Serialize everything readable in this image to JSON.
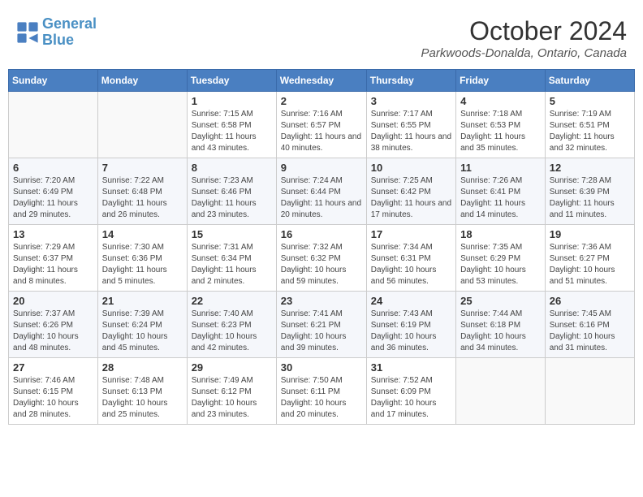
{
  "logo": {
    "line1": "General",
    "line2": "Blue"
  },
  "title": "October 2024",
  "location": "Parkwoods-Donalda, Ontario, Canada",
  "days_of_week": [
    "Sunday",
    "Monday",
    "Tuesday",
    "Wednesday",
    "Thursday",
    "Friday",
    "Saturday"
  ],
  "weeks": [
    [
      {
        "day": "",
        "content": ""
      },
      {
        "day": "",
        "content": ""
      },
      {
        "day": "1",
        "content": "Sunrise: 7:15 AM\nSunset: 6:58 PM\nDaylight: 11 hours and 43 minutes."
      },
      {
        "day": "2",
        "content": "Sunrise: 7:16 AM\nSunset: 6:57 PM\nDaylight: 11 hours and 40 minutes."
      },
      {
        "day": "3",
        "content": "Sunrise: 7:17 AM\nSunset: 6:55 PM\nDaylight: 11 hours and 38 minutes."
      },
      {
        "day": "4",
        "content": "Sunrise: 7:18 AM\nSunset: 6:53 PM\nDaylight: 11 hours and 35 minutes."
      },
      {
        "day": "5",
        "content": "Sunrise: 7:19 AM\nSunset: 6:51 PM\nDaylight: 11 hours and 32 minutes."
      }
    ],
    [
      {
        "day": "6",
        "content": "Sunrise: 7:20 AM\nSunset: 6:49 PM\nDaylight: 11 hours and 29 minutes."
      },
      {
        "day": "7",
        "content": "Sunrise: 7:22 AM\nSunset: 6:48 PM\nDaylight: 11 hours and 26 minutes."
      },
      {
        "day": "8",
        "content": "Sunrise: 7:23 AM\nSunset: 6:46 PM\nDaylight: 11 hours and 23 minutes."
      },
      {
        "day": "9",
        "content": "Sunrise: 7:24 AM\nSunset: 6:44 PM\nDaylight: 11 hours and 20 minutes."
      },
      {
        "day": "10",
        "content": "Sunrise: 7:25 AM\nSunset: 6:42 PM\nDaylight: 11 hours and 17 minutes."
      },
      {
        "day": "11",
        "content": "Sunrise: 7:26 AM\nSunset: 6:41 PM\nDaylight: 11 hours and 14 minutes."
      },
      {
        "day": "12",
        "content": "Sunrise: 7:28 AM\nSunset: 6:39 PM\nDaylight: 11 hours and 11 minutes."
      }
    ],
    [
      {
        "day": "13",
        "content": "Sunrise: 7:29 AM\nSunset: 6:37 PM\nDaylight: 11 hours and 8 minutes."
      },
      {
        "day": "14",
        "content": "Sunrise: 7:30 AM\nSunset: 6:36 PM\nDaylight: 11 hours and 5 minutes."
      },
      {
        "day": "15",
        "content": "Sunrise: 7:31 AM\nSunset: 6:34 PM\nDaylight: 11 hours and 2 minutes."
      },
      {
        "day": "16",
        "content": "Sunrise: 7:32 AM\nSunset: 6:32 PM\nDaylight: 10 hours and 59 minutes."
      },
      {
        "day": "17",
        "content": "Sunrise: 7:34 AM\nSunset: 6:31 PM\nDaylight: 10 hours and 56 minutes."
      },
      {
        "day": "18",
        "content": "Sunrise: 7:35 AM\nSunset: 6:29 PM\nDaylight: 10 hours and 53 minutes."
      },
      {
        "day": "19",
        "content": "Sunrise: 7:36 AM\nSunset: 6:27 PM\nDaylight: 10 hours and 51 minutes."
      }
    ],
    [
      {
        "day": "20",
        "content": "Sunrise: 7:37 AM\nSunset: 6:26 PM\nDaylight: 10 hours and 48 minutes."
      },
      {
        "day": "21",
        "content": "Sunrise: 7:39 AM\nSunset: 6:24 PM\nDaylight: 10 hours and 45 minutes."
      },
      {
        "day": "22",
        "content": "Sunrise: 7:40 AM\nSunset: 6:23 PM\nDaylight: 10 hours and 42 minutes."
      },
      {
        "day": "23",
        "content": "Sunrise: 7:41 AM\nSunset: 6:21 PM\nDaylight: 10 hours and 39 minutes."
      },
      {
        "day": "24",
        "content": "Sunrise: 7:43 AM\nSunset: 6:19 PM\nDaylight: 10 hours and 36 minutes."
      },
      {
        "day": "25",
        "content": "Sunrise: 7:44 AM\nSunset: 6:18 PM\nDaylight: 10 hours and 34 minutes."
      },
      {
        "day": "26",
        "content": "Sunrise: 7:45 AM\nSunset: 6:16 PM\nDaylight: 10 hours and 31 minutes."
      }
    ],
    [
      {
        "day": "27",
        "content": "Sunrise: 7:46 AM\nSunset: 6:15 PM\nDaylight: 10 hours and 28 minutes."
      },
      {
        "day": "28",
        "content": "Sunrise: 7:48 AM\nSunset: 6:13 PM\nDaylight: 10 hours and 25 minutes."
      },
      {
        "day": "29",
        "content": "Sunrise: 7:49 AM\nSunset: 6:12 PM\nDaylight: 10 hours and 23 minutes."
      },
      {
        "day": "30",
        "content": "Sunrise: 7:50 AM\nSunset: 6:11 PM\nDaylight: 10 hours and 20 minutes."
      },
      {
        "day": "31",
        "content": "Sunrise: 7:52 AM\nSunset: 6:09 PM\nDaylight: 10 hours and 17 minutes."
      },
      {
        "day": "",
        "content": ""
      },
      {
        "day": "",
        "content": ""
      }
    ]
  ]
}
